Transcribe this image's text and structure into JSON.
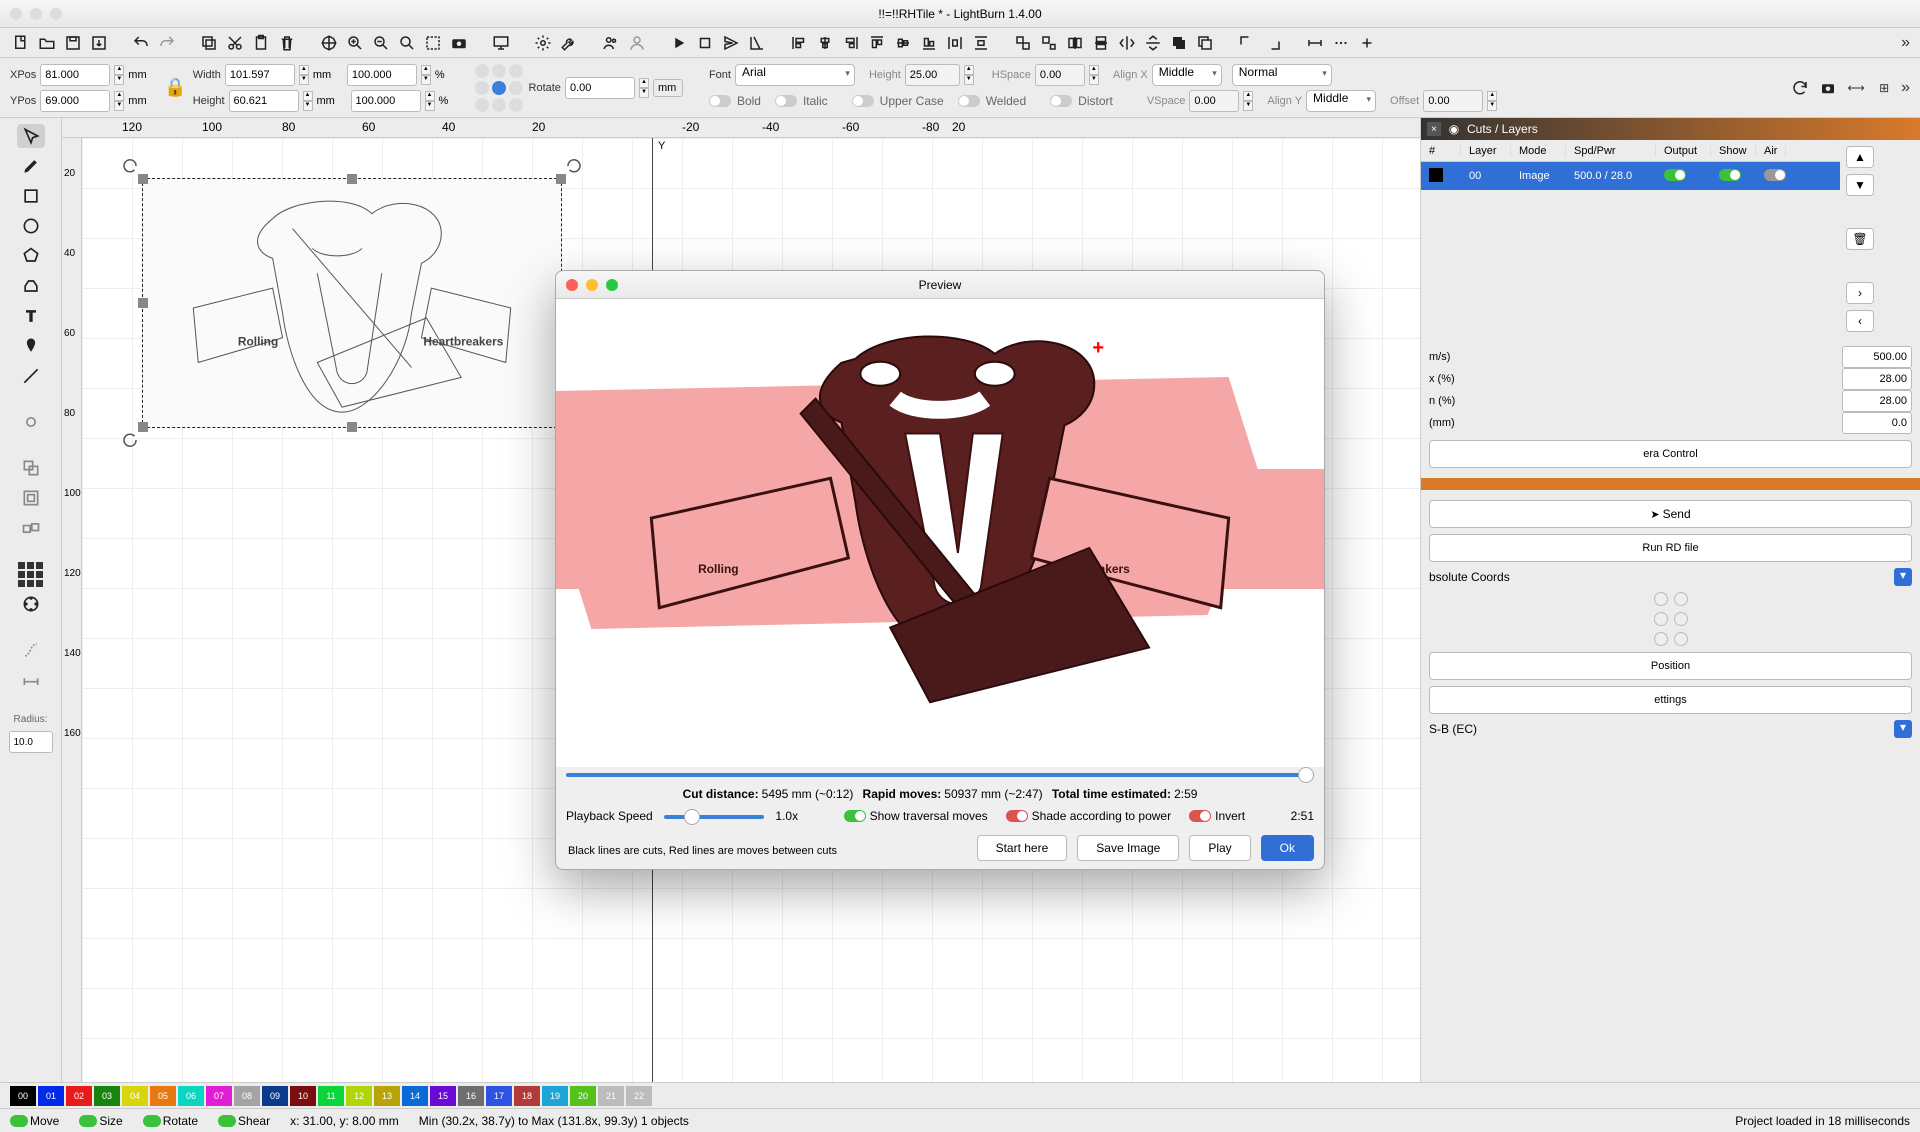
{
  "title": "!!=!!RHTile * - LightBurn 1.4.00",
  "props": {
    "xpos_label": "XPos",
    "xpos": "81.000",
    "xpos_unit": "mm",
    "ypos_label": "YPos",
    "ypos": "69.000",
    "ypos_unit": "mm",
    "width_label": "Width",
    "width": "101.597",
    "width_unit": "mm",
    "width_pct": "100.000",
    "pct": "%",
    "height_label": "Height",
    "height": "60.621",
    "height_unit": "mm",
    "height_pct": "100.000",
    "rotate_label": "Rotate",
    "rotate": "0.00",
    "rotate_unit": "mm",
    "font_label": "Font",
    "font": "Arial",
    "textheight_label": "Height",
    "textheight": "25.00",
    "hspace_label": "HSpace",
    "hspace": "0.00",
    "alignx_label": "Align X",
    "alignx": "Middle",
    "style": "Normal",
    "vspace_label": "VSpace",
    "vspace": "0.00",
    "aligny_label": "Align Y",
    "aligny": "Middle",
    "offset_label": "Offset",
    "offset": "0.00",
    "bold": "Bold",
    "italic": "Italic",
    "upper": "Upper Case",
    "distort": "Distort",
    "welded": "Welded"
  },
  "ruler_h": [
    "120",
    "100",
    "80",
    "60",
    "40",
    "20",
    "-20",
    "-40",
    "-60",
    "-80",
    "20"
  ],
  "ruler_v": [
    "20",
    "40",
    "60",
    "80",
    "100",
    "120",
    "140",
    "160"
  ],
  "ruler_h2": [
    "120",
    "100",
    "80",
    "60",
    "40",
    "20"
  ],
  "sketch": {
    "band_left": "Rolling",
    "band_right": "Heartbreakers"
  },
  "layers": {
    "tab": "Cuts / Layers",
    "headers": [
      "#",
      "Layer",
      "Mode",
      "Spd/Pwr",
      "Output",
      "Show",
      "Air"
    ],
    "row": {
      "color": "black",
      "layer": "00",
      "mode": "Image",
      "spdpwr": "500.0 / 28.0"
    }
  },
  "rightside": {
    "nums": [
      {
        "label": "m/s)",
        "val": "500.00"
      },
      {
        "label": "x (%)",
        "val": "28.00"
      },
      {
        "label": "n (%)",
        "val": "28.00"
      },
      {
        "label": "(mm)",
        "val": "0.0"
      }
    ],
    "camctl": "era Control",
    "send": "Send",
    "runrd": "Run RD file",
    "abscoords": "bsolute Coords",
    "position": "Position",
    "settings": "ettings",
    "device": "S-B (EC)"
  },
  "radius_label": "Radius:",
  "radius": "10.0",
  "preview": {
    "title": "Preview",
    "info_cut_label": "Cut distance:",
    "info_cut": "5495 mm (~0:12)",
    "info_rapid_label": "Rapid moves:",
    "info_rapid": "50937 mm (~2:47)",
    "info_time_label": "Total time estimated:",
    "info_time": "2:59",
    "playback_label": "Playback Speed",
    "playback_val": "1.0x",
    "show_trav": "Show traversal moves",
    "shade": "Shade according to power",
    "invert": "Invert",
    "dur": "2:51",
    "note": "Black lines are cuts, Red lines are moves between cuts",
    "btns": {
      "start": "Start here",
      "save": "Save Image",
      "play": "Play",
      "ok": "Ok"
    }
  },
  "palette": [
    {
      "n": "00",
      "c": "#000"
    },
    {
      "n": "01",
      "c": "#0029e8"
    },
    {
      "n": "02",
      "c": "#e81a1a"
    },
    {
      "n": "03",
      "c": "#18830f"
    },
    {
      "n": "04",
      "c": "#d7d50c"
    },
    {
      "n": "05",
      "c": "#e87812"
    },
    {
      "n": "06",
      "c": "#0bd6c2"
    },
    {
      "n": "07",
      "c": "#e01ed4"
    },
    {
      "n": "08",
      "c": "#a4a4a4"
    },
    {
      "n": "09",
      "c": "#0c3a8c"
    },
    {
      "n": "10",
      "c": "#7a0d0d"
    },
    {
      "n": "11",
      "c": "#0ad63c"
    },
    {
      "n": "12",
      "c": "#b0d60a"
    },
    {
      "n": "13",
      "c": "#b7a30a"
    },
    {
      "n": "14",
      "c": "#0a6bd6"
    },
    {
      "n": "15",
      "c": "#6b0ad6"
    },
    {
      "n": "16",
      "c": "#6e6e6e"
    },
    {
      "n": "17",
      "c": "#2e52e2"
    },
    {
      "n": "18",
      "c": "#b43a3a"
    },
    {
      "n": "19",
      "c": "#1ca5d6"
    },
    {
      "n": "20",
      "c": "#55c21c"
    },
    {
      "n": "21",
      "c": "#bcbcbc"
    },
    {
      "n": "22",
      "c": "#bcbcbc"
    }
  ],
  "status": {
    "move": "Move",
    "size": "Size",
    "rotate": "Rotate",
    "shear": "Shear",
    "cursor": "x: 31.00, y: 8.00 mm",
    "bounds": "Min (30.2x, 38.7y) to Max (131.8x, 99.3y)  1 objects",
    "msg": "Project loaded in 18 milliseconds"
  }
}
